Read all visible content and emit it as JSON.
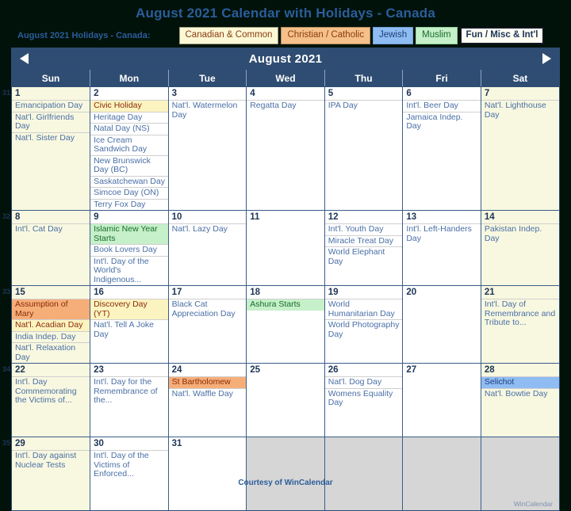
{
  "title": "August 2021 Calendar with Holidays - Canada",
  "legend": {
    "label": "August 2021 Holidays - Canada:",
    "tabs": [
      {
        "name": "Canadian & Common",
        "key": "canadian",
        "color": "#fcf8d6"
      },
      {
        "name": "Christian / Catholic",
        "key": "christian",
        "color": "#f6c08a"
      },
      {
        "name": "Jewish",
        "key": "jewish",
        "color": "#8fbcf2"
      },
      {
        "name": "Muslim",
        "key": "muslim",
        "color": "#c5f0c9"
      },
      {
        "name": "Fun / Misc & Int'l",
        "key": "fun",
        "color": "#fdfdf4"
      }
    ]
  },
  "month": {
    "title": "August 2021",
    "prev_icon": "left-triangle-icon",
    "next_icon": "right-triangle-icon"
  },
  "weekday_headers": [
    "Sun",
    "Mon",
    "Tue",
    "Wed",
    "Thu",
    "Fri",
    "Sat"
  ],
  "week_numbers": [
    "31",
    "32",
    "33",
    "34",
    "35"
  ],
  "weeks": [
    {
      "num": "31",
      "days": [
        {
          "n": "1",
          "weekend": true,
          "events": [
            {
              "t": "Emancipation Day",
              "c": "plain"
            },
            {
              "t": "Nat'l. Girlfriends Day",
              "c": "plain"
            },
            {
              "t": "Nat'l. Sister Day",
              "c": "plain"
            }
          ]
        },
        {
          "n": "2",
          "weekend": false,
          "events": [
            {
              "t": "Civic Holiday",
              "c": "hl-can"
            },
            {
              "t": "Heritage Day",
              "c": "plain"
            },
            {
              "t": "Natal Day (NS)",
              "c": "plain"
            },
            {
              "t": "Ice Cream Sandwich Day",
              "c": "plain"
            },
            {
              "t": "New Brunswick Day (BC)",
              "c": "plain"
            },
            {
              "t": "Saskatchewan Day",
              "c": "plain"
            },
            {
              "t": "Simcoe Day (ON)",
              "c": "plain"
            },
            {
              "t": "Terry Fox Day",
              "c": "plain"
            }
          ]
        },
        {
          "n": "3",
          "weekend": false,
          "events": [
            {
              "t": "Nat'l. Watermelon Day",
              "c": "plain"
            }
          ]
        },
        {
          "n": "4",
          "weekend": false,
          "events": [
            {
              "t": "Regatta Day",
              "c": "plain"
            }
          ]
        },
        {
          "n": "5",
          "weekend": false,
          "events": [
            {
              "t": "IPA Day",
              "c": "plain"
            }
          ]
        },
        {
          "n": "6",
          "weekend": false,
          "events": [
            {
              "t": "Int'l. Beer Day",
              "c": "plain"
            },
            {
              "t": "Jamaica Indep. Day",
              "c": "plain"
            }
          ]
        },
        {
          "n": "7",
          "weekend": true,
          "events": [
            {
              "t": "Nat'l. Lighthouse Day",
              "c": "plain"
            }
          ]
        }
      ]
    },
    {
      "num": "32",
      "days": [
        {
          "n": "8",
          "weekend": true,
          "events": [
            {
              "t": "Int'l. Cat Day",
              "c": "plain"
            }
          ]
        },
        {
          "n": "9",
          "weekend": false,
          "events": [
            {
              "t": "Islamic New Year Starts",
              "c": "hl-mus"
            },
            {
              "t": "Book Lovers Day",
              "c": "plain"
            },
            {
              "t": "Int'l. Day of the World's Indigenous...",
              "c": "plain"
            }
          ]
        },
        {
          "n": "10",
          "weekend": false,
          "events": [
            {
              "t": "Nat'l. Lazy Day",
              "c": "plain"
            }
          ]
        },
        {
          "n": "11",
          "weekend": false,
          "events": []
        },
        {
          "n": "12",
          "weekend": false,
          "events": [
            {
              "t": "Int'l. Youth Day",
              "c": "plain"
            },
            {
              "t": "Miracle Treat Day",
              "c": "plain"
            },
            {
              "t": "World Elephant Day",
              "c": "plain"
            }
          ]
        },
        {
          "n": "13",
          "weekend": false,
          "events": [
            {
              "t": "Int'l. Left-Handers Day",
              "c": "plain"
            }
          ]
        },
        {
          "n": "14",
          "weekend": true,
          "events": [
            {
              "t": "Pakistan Indep. Day",
              "c": "plain"
            }
          ]
        }
      ]
    },
    {
      "num": "33",
      "days": [
        {
          "n": "15",
          "weekend": true,
          "events": [
            {
              "t": "Assumption of Mary",
              "c": "hl-chr"
            },
            {
              "t": "Nat'l. Acadian Day",
              "c": "hl-can"
            },
            {
              "t": "India Indep. Day",
              "c": "plain"
            },
            {
              "t": "Nat'l. Relaxation Day",
              "c": "plain"
            }
          ]
        },
        {
          "n": "16",
          "weekend": false,
          "events": [
            {
              "t": "Discovery Day (YT)",
              "c": "hl-can"
            },
            {
              "t": "Nat'l. Tell A Joke Day",
              "c": "plain"
            }
          ]
        },
        {
          "n": "17",
          "weekend": false,
          "events": [
            {
              "t": "Black Cat Appreciation Day",
              "c": "plain"
            }
          ]
        },
        {
          "n": "18",
          "weekend": false,
          "events": [
            {
              "t": "Ashura Starts",
              "c": "hl-mus"
            }
          ]
        },
        {
          "n": "19",
          "weekend": false,
          "events": [
            {
              "t": "World Humanitarian Day",
              "c": "plain"
            },
            {
              "t": "World Photography Day",
              "c": "plain"
            }
          ]
        },
        {
          "n": "20",
          "weekend": false,
          "events": []
        },
        {
          "n": "21",
          "weekend": true,
          "events": [
            {
              "t": "Int'l. Day of Remembrance and Tribute to...",
              "c": "plain"
            }
          ]
        }
      ]
    },
    {
      "num": "34",
      "days": [
        {
          "n": "22",
          "weekend": true,
          "events": [
            {
              "t": "Int'l. Day Commemorating the Victims of...",
              "c": "plain"
            }
          ]
        },
        {
          "n": "23",
          "weekend": false,
          "events": [
            {
              "t": "Int'l. Day for the Remembrance of the...",
              "c": "plain"
            }
          ]
        },
        {
          "n": "24",
          "weekend": false,
          "events": [
            {
              "t": "St Bartholomew",
              "c": "hl-chr"
            },
            {
              "t": "Nat'l. Waffle Day",
              "c": "plain"
            }
          ]
        },
        {
          "n": "25",
          "weekend": false,
          "events": []
        },
        {
          "n": "26",
          "weekend": false,
          "events": [
            {
              "t": "Nat'l. Dog Day",
              "c": "plain"
            },
            {
              "t": "Womens Equality Day",
              "c": "plain"
            }
          ]
        },
        {
          "n": "27",
          "weekend": false,
          "events": []
        },
        {
          "n": "28",
          "weekend": true,
          "events": [
            {
              "t": "Selichot",
              "c": "hl-jew"
            },
            {
              "t": "Nat'l. Bowtie Day",
              "c": "plain"
            }
          ]
        }
      ]
    },
    {
      "num": "35",
      "days": [
        {
          "n": "29",
          "weekend": true,
          "events": [
            {
              "t": "Int'l. Day against Nuclear Tests",
              "c": "plain"
            }
          ]
        },
        {
          "n": "30",
          "weekend": false,
          "events": [
            {
              "t": "Int'l. Day of the Victims of Enforced...",
              "c": "plain"
            }
          ]
        },
        {
          "n": "31",
          "weekend": false,
          "events": []
        },
        {
          "n": "",
          "weekend": false,
          "blank": true,
          "events": []
        },
        {
          "n": "",
          "weekend": false,
          "blank": true,
          "events": []
        },
        {
          "n": "",
          "weekend": false,
          "blank": true,
          "events": []
        },
        {
          "n": "",
          "weekend": false,
          "blank": true,
          "events": []
        }
      ]
    }
  ],
  "watermark": "WinCalendar",
  "footer": "Courtesy of WinCalendar"
}
